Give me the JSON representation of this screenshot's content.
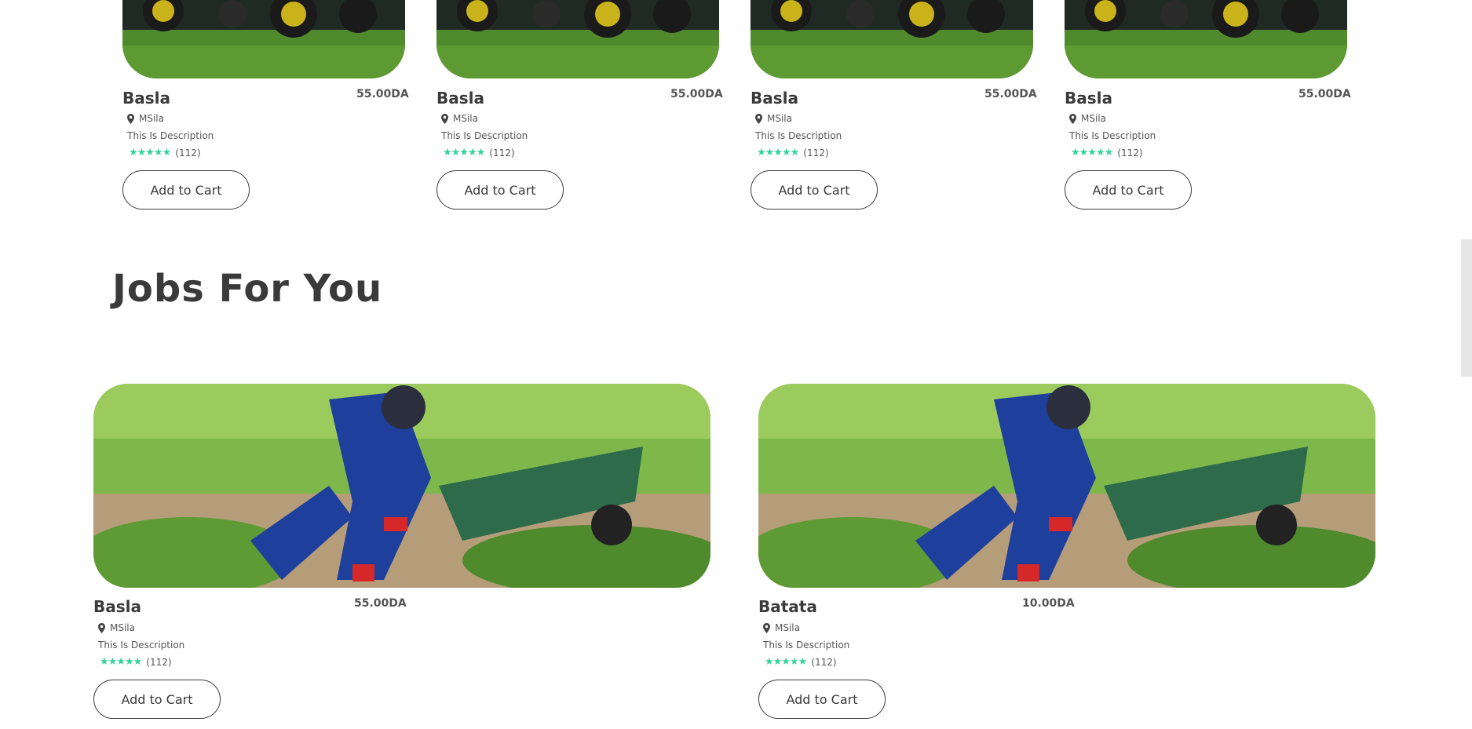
{
  "products": [
    {
      "title": "Basla",
      "price": "55.00DA",
      "location": "MSila",
      "description": "This Is Description",
      "stars": "★★★★★",
      "reviews": "(112)",
      "button": "Add to Cart"
    },
    {
      "title": "Basla",
      "price": "55.00DA",
      "location": "MSila",
      "description": "This Is Description",
      "stars": "★★★★★",
      "reviews": "(112)",
      "button": "Add to Cart"
    },
    {
      "title": "Basla",
      "price": "55.00DA",
      "location": "MSila",
      "description": "This Is Description",
      "stars": "★★★★★",
      "reviews": "(112)",
      "button": "Add to Cart"
    },
    {
      "title": "Basla",
      "price": "55.00DA",
      "location": "MSila",
      "description": "This Is Description",
      "stars": "★★★★★",
      "reviews": "(112)",
      "button": "Add to Cart"
    }
  ],
  "jobs_section": {
    "title": "Jobs For You"
  },
  "jobs": [
    {
      "title": "Basla",
      "price": "55.00DA",
      "location": "MSila",
      "description": "This Is Description",
      "stars": "★★★★★",
      "reviews": "(112)",
      "button": "Add to Cart"
    },
    {
      "title": "Batata",
      "price": "10.00DA",
      "location": "MSila",
      "description": "This Is Description",
      "stars": "★★★★★",
      "reviews": "(112)",
      "button": "Add to Cart"
    }
  ],
  "icons": {
    "location": "map-pin-icon",
    "rating": "star-icon"
  },
  "colors": {
    "accent_stars": "#34d399",
    "text": "#3a3a3a"
  }
}
